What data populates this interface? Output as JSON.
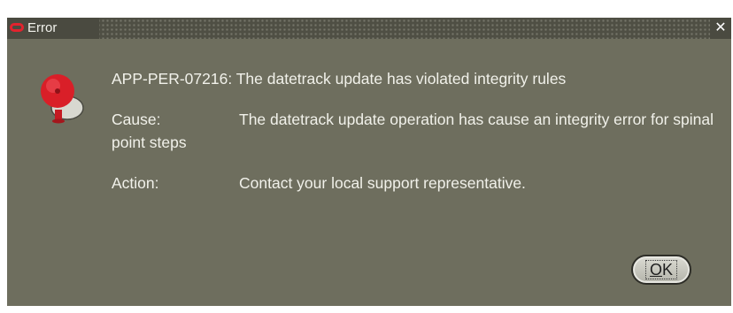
{
  "window": {
    "title": "Error",
    "close_glyph": "✕",
    "icons": {
      "logo": "oracle-logo-icon",
      "alert": "alarm-bell-icon",
      "close": "close-icon"
    }
  },
  "dialog": {
    "message": "APP-PER-07216: The datetrack update has violated integrity rules",
    "cause_label": "Cause:",
    "cause_text": "The datetrack update operation has cause an integrity error for spinal point steps",
    "action_label": "Action:",
    "action_text": "Contact your local support representative.",
    "ok_button": {
      "mnemonic": "O",
      "rest": "K"
    }
  },
  "colors": {
    "background": "#6e6e5e",
    "titlebar": "#4f4f44",
    "text": "#f1f1ea",
    "brand_red": "#e2232e"
  }
}
